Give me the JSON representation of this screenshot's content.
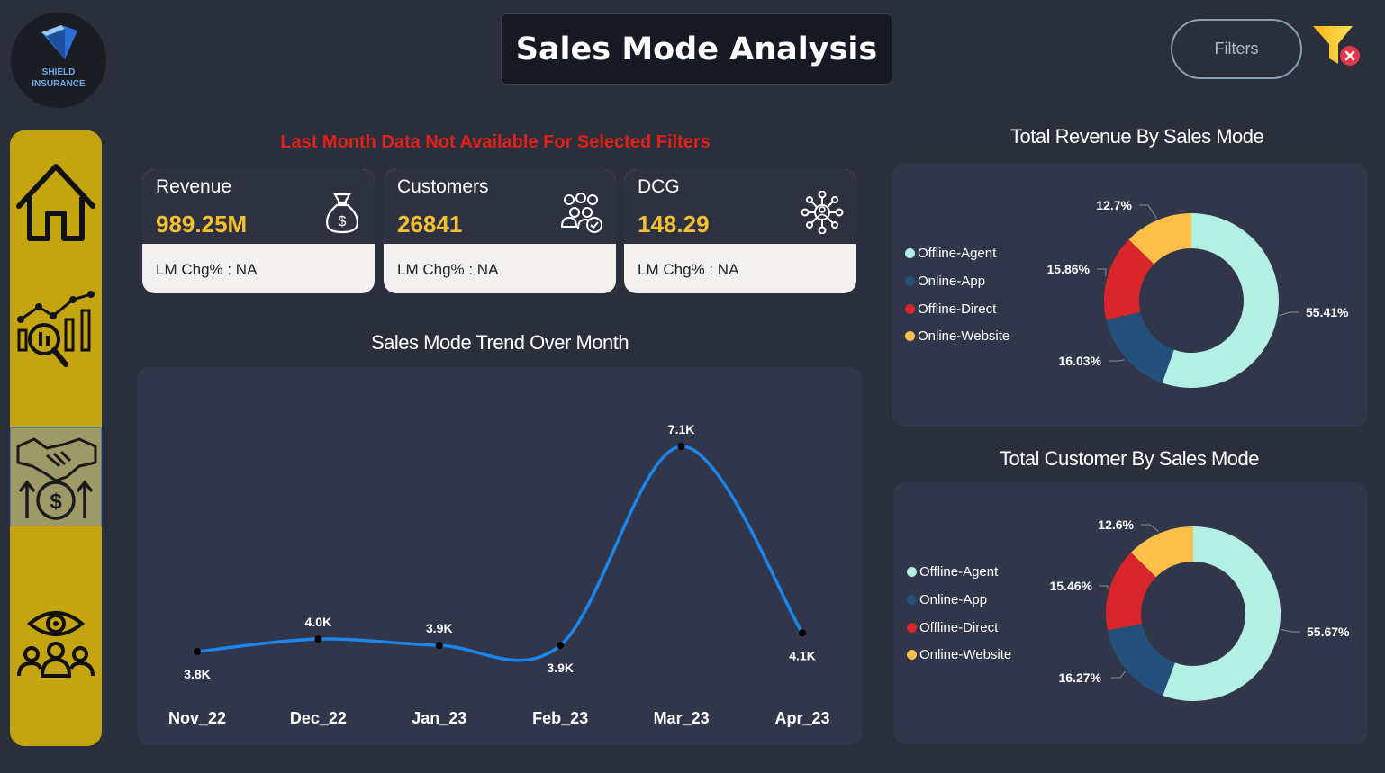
{
  "logo": {
    "line1": "SHIELD",
    "line2": "INSURANCE"
  },
  "header": {
    "title": "Sales Mode Analysis",
    "filters_label": "Filters"
  },
  "sidebar": {
    "items": [
      {
        "name": "home-icon"
      },
      {
        "name": "analytics-icon"
      },
      {
        "name": "sales-deal-icon",
        "active": true
      },
      {
        "name": "customer-view-icon"
      }
    ]
  },
  "warning": "Last Month Data Not Available For Selected Filters",
  "kpis": [
    {
      "label": "Revenue",
      "value": "989.25M",
      "change": "LM Chg% : NA",
      "icon": "money-bag-icon"
    },
    {
      "label": "Customers",
      "value": "26841",
      "change": "LM Chg% : NA",
      "icon": "customers-icon"
    },
    {
      "label": "DCG",
      "value": "148.29",
      "change": "LM Chg% : NA",
      "icon": "network-icon"
    }
  ],
  "colors": {
    "offline_agent": "#b4efe4",
    "online_app": "#24507c",
    "offline_direct": "#d9262a",
    "online_website": "#fcc04a",
    "line": "#1a86ee",
    "accent": "#c4a411"
  },
  "chart_data": [
    {
      "type": "line",
      "title": "Sales Mode Trend Over Month",
      "categories": [
        "Nov_22",
        "Dec_22",
        "Jan_23",
        "Feb_23",
        "Mar_23",
        "Apr_23"
      ],
      "values": [
        3.8,
        4.0,
        3.9,
        3.9,
        7.1,
        4.1
      ],
      "data_labels": [
        "3.8K",
        "4.0K",
        "3.9K",
        "3.9K",
        "7.1K",
        "4.1K"
      ],
      "unit": "K",
      "xlabel": "",
      "ylabel": ""
    },
    {
      "type": "pie",
      "title": "Total Revenue By Sales  Mode",
      "categories": [
        "Offline-Agent",
        "Online-App",
        "Offline-Direct",
        "Online-Website"
      ],
      "values": [
        55.41,
        16.03,
        15.86,
        12.7
      ],
      "data_labels": [
        "55.41%",
        "16.03%",
        "15.86%",
        "12.7%"
      ],
      "legend": "left"
    },
    {
      "type": "pie",
      "title": "Total Customer By Sales  Mode",
      "categories": [
        "Offline-Agent",
        "Online-App",
        "Offline-Direct",
        "Online-Website"
      ],
      "values": [
        55.67,
        16.27,
        15.46,
        12.6
      ],
      "data_labels": [
        "55.67%",
        "16.27%",
        "15.46%",
        "12.6%"
      ],
      "legend": "left"
    }
  ]
}
